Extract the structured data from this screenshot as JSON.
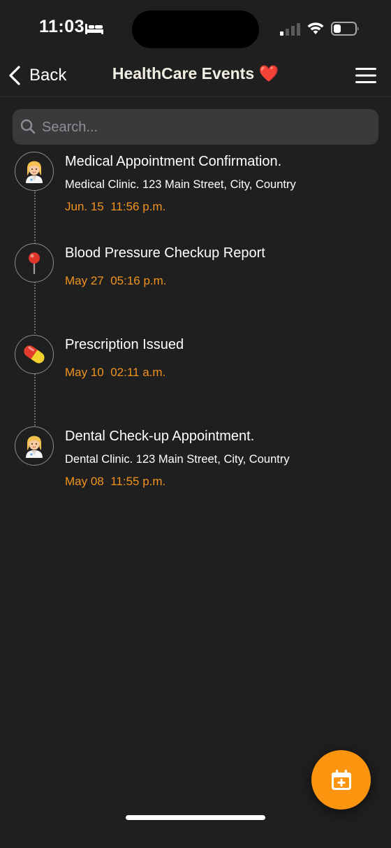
{
  "status_bar": {
    "time": "11:03",
    "focus_icon": "bed-icon",
    "signal_icon": "cellular-signal-icon",
    "wifi_icon": "wifi-icon",
    "battery_icon": "battery-icon"
  },
  "nav": {
    "back_label": "Back",
    "title": "HealthCare Events ❤️",
    "menu_icon": "hamburger-menu-icon"
  },
  "search": {
    "placeholder": "Search...",
    "value": ""
  },
  "events": [
    {
      "icon": "health-worker-icon",
      "icon_glyph": "👩‍⚕️",
      "title": "Medical Appointment Confirmation.",
      "location": "Medical Clinic. 123 Main Street, City, Country",
      "datetime": "Jun. 15  11:56 p.m."
    },
    {
      "icon": "pushpin-icon",
      "icon_glyph": "📍",
      "title": "Blood Pressure Checkup Report",
      "location": "",
      "datetime": "May 27  05:16 p.m."
    },
    {
      "icon": "pill-icon",
      "icon_glyph": "💊",
      "title": "Prescription Issued",
      "location": "",
      "datetime": "May 10  02:11 a.m."
    },
    {
      "icon": "health-worker-icon",
      "icon_glyph": "👩‍⚕️",
      "title": "Dental Check-up Appointment.",
      "location": "Dental Clinic. 123 Main Street, City, Country",
      "datetime": "May 08  11:55 p.m."
    }
  ],
  "fab": {
    "icon": "calendar-add-icon"
  },
  "colors": {
    "background": "#1f1f1f",
    "accent": "#fb950f",
    "datetime": "#f2931e",
    "search_bg": "#3a3a3c"
  }
}
